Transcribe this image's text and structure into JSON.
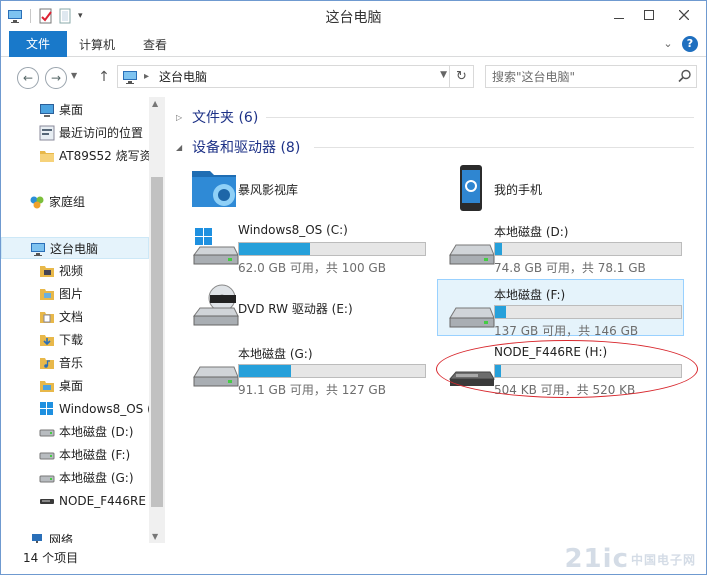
{
  "window": {
    "title": "这台电脑"
  },
  "ribbon": {
    "tabs": [
      "文件",
      "计算机",
      "查看"
    ]
  },
  "nav": {
    "back_label": "←",
    "fwd_label": "→",
    "up_label": "↑",
    "address": {
      "crumb": "这台电脑"
    },
    "search": {
      "placeholder": "搜索\"这台电脑\""
    }
  },
  "sidebar": {
    "items": [
      {
        "label": "桌面",
        "icon": "desktop-icon"
      },
      {
        "label": "最近访问的位置",
        "icon": "recent-places-icon"
      },
      {
        "label": "AT89S52 烧写资",
        "icon": "folder-icon"
      },
      {
        "label": "家庭组",
        "icon": "homegroup-icon"
      },
      {
        "label": "这台电脑",
        "icon": "computer-icon",
        "selected": true
      },
      {
        "label": "视频",
        "icon": "videos-folder-icon"
      },
      {
        "label": "图片",
        "icon": "pictures-folder-icon"
      },
      {
        "label": "文档",
        "icon": "documents-folder-icon"
      },
      {
        "label": "下载",
        "icon": "downloads-folder-icon"
      },
      {
        "label": "音乐",
        "icon": "music-folder-icon"
      },
      {
        "label": "桌面",
        "icon": "desktop-folder-icon"
      },
      {
        "label": "Windows8_OS (",
        "icon": "windows-drive-icon"
      },
      {
        "label": "本地磁盘 (D:)",
        "icon": "drive-icon"
      },
      {
        "label": "本地磁盘 (F:)",
        "icon": "drive-icon"
      },
      {
        "label": "本地磁盘 (G:)",
        "icon": "drive-icon"
      },
      {
        "label": "NODE_F446RE (",
        "icon": "removable-drive-icon"
      },
      {
        "label": "网络",
        "icon": "network-icon"
      }
    ]
  },
  "content": {
    "groups": [
      {
        "label": "文件夹 (6)",
        "collapsed": true
      },
      {
        "label": "设备和驱动器 (8)",
        "collapsed": false
      }
    ],
    "tiles": [
      {
        "name": "暴风影视库",
        "icon": "media-library-icon"
      },
      {
        "name": "我的手机",
        "icon": "phone-icon"
      },
      {
        "name": "Windows8_OS (C:)",
        "icon": "windows-drive-icon",
        "used_fraction": 0.38,
        "size": "62.0 GB 可用，共 100 GB"
      },
      {
        "name": "本地磁盘 (D:)",
        "icon": "drive-icon",
        "used_fraction": 0.04,
        "size": "74.8 GB 可用，共 78.1 GB"
      },
      {
        "name": "DVD RW 驱动器 (E:)",
        "icon": "dvd-drive-icon"
      },
      {
        "name": "本地磁盘 (F:)",
        "icon": "drive-icon",
        "used_fraction": 0.06,
        "size": "137 GB 可用，共 146 GB",
        "selected": true
      },
      {
        "name": "本地磁盘 (G:)",
        "icon": "drive-icon",
        "used_fraction": 0.28,
        "size": "91.1 GB 可用，共 127 GB"
      },
      {
        "name": "NODE_F446RE (H:)",
        "icon": "removable-drive-icon",
        "used_fraction": 0.03,
        "size": "504 KB 可用，共 520 KB"
      }
    ]
  },
  "status": {
    "count": "14 个项目"
  },
  "watermark": {
    "text": "21ic",
    "sub": "中国电子网"
  },
  "colors": {
    "accent": "#1979ca",
    "bar_fill": "#26a0da",
    "annotation": "#d8282e"
  }
}
